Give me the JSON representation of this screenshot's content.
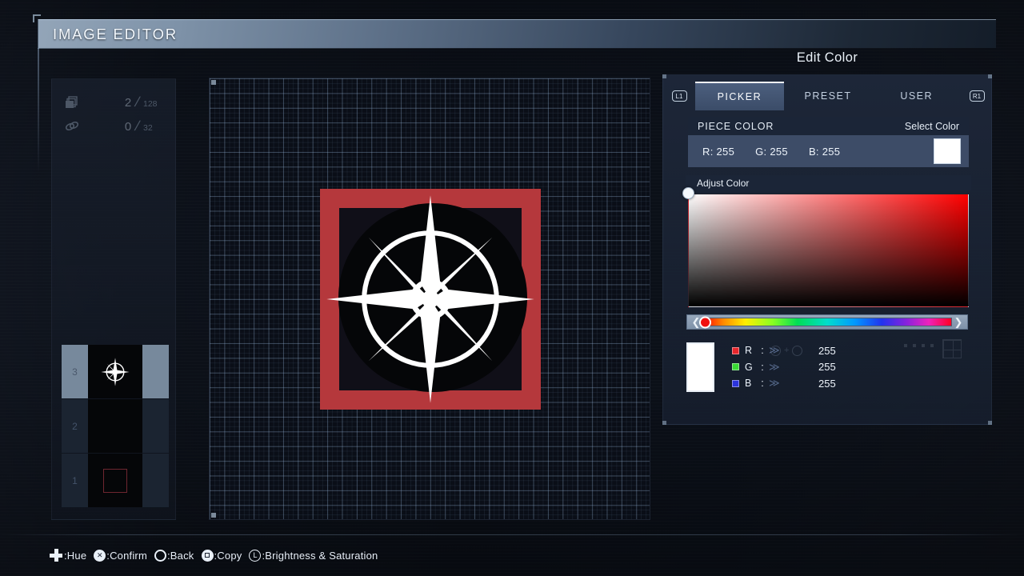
{
  "window": {
    "title": "IMAGE EDITOR"
  },
  "sidebar": {
    "counters": [
      {
        "icon": "layers-stack-icon",
        "current": "2",
        "separator": "/",
        "max": "128"
      },
      {
        "icon": "chain-link-icon",
        "current": "0",
        "separator": "/",
        "max": "32"
      }
    ],
    "layers": [
      {
        "number": "3",
        "content": "compass-rose",
        "selected": true
      },
      {
        "number": "2",
        "content": "empty",
        "selected": false
      },
      {
        "number": "1",
        "content": "red-square",
        "selected": false
      }
    ]
  },
  "canvas": {
    "artwork_name": "compass-rose-emblem",
    "frame_color": "#b5383c",
    "disc_color": "#050608",
    "star_color": "#ffffff"
  },
  "edit_color": {
    "title": "Edit Color",
    "shoulder_left": "L1",
    "shoulder_right": "R1",
    "tabs": [
      {
        "label": "PICKER",
        "active": true
      },
      {
        "label": "PRESET",
        "active": false
      },
      {
        "label": "USER",
        "active": false
      }
    ],
    "piece_color": {
      "header_label": "PIECE COLOR",
      "action_label": "Select Color",
      "r_text": "R: 255",
      "g_text": "G: 255",
      "b_text": "B: 255",
      "swatch_hex": "#ffffff"
    },
    "adjust_color": {
      "header_label": "Adjust Color",
      "cursor_x_pct": 0,
      "cursor_y_pct": 0,
      "base_hue_hex": "#ff0000"
    },
    "hue_slider": {
      "left_arrow": "❮",
      "right_arrow": "❯",
      "knob_hex": "#f01010",
      "knob_position_pct": 0
    },
    "rgb_sliders": {
      "preview_hex": "#ffffff",
      "arrows": "≫",
      "rows": [
        {
          "chip_hex": "#e8262c",
          "name": "R",
          "colon": ":",
          "value": "255"
        },
        {
          "chip_hex": "#3ad935",
          "name": "G",
          "colon": ":",
          "value": "255"
        },
        {
          "chip_hex": "#2c34dd",
          "name": "B",
          "colon": ":",
          "value": "255"
        }
      ]
    }
  },
  "footer": {
    "legend": [
      {
        "icon": "dpad-icon",
        "glyph": "",
        "label": ":Hue"
      },
      {
        "icon": "cross-button-icon",
        "glyph": "✕",
        "label": ":Confirm"
      },
      {
        "icon": "circle-button-icon",
        "glyph": "",
        "label": ":Back"
      },
      {
        "icon": "square-button-icon",
        "glyph": "",
        "label": ":Copy"
      },
      {
        "icon": "l-button-icon",
        "glyph": "L",
        "label": ":Brightness & Saturation"
      }
    ]
  }
}
